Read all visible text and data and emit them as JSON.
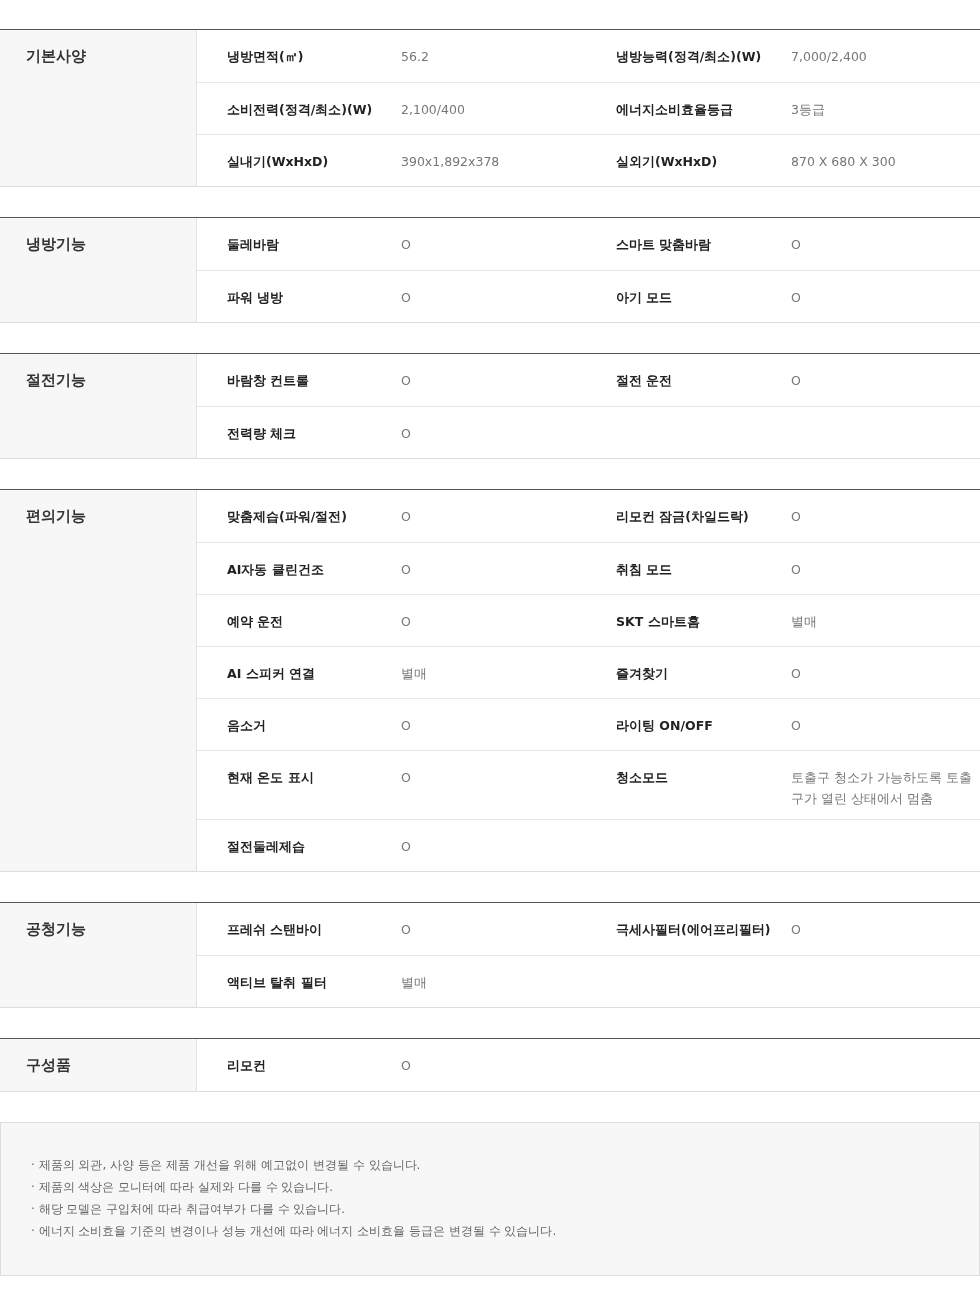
{
  "sections": [
    {
      "title": "기본사양",
      "rows": [
        [
          {
            "label": "냉방면적(㎡)",
            "value": "56.2"
          },
          {
            "label": "냉방능력(정격/최소)(W)",
            "value": "7,000/2,400"
          }
        ],
        [
          {
            "label": "소비전력(정격/최소)(W)",
            "value": "2,100/400"
          },
          {
            "label": "에너지소비효율등급",
            "value": "3등급"
          }
        ],
        [
          {
            "label": "실내기(WxHxD)",
            "value": "390x1,892x378"
          },
          {
            "label": "실외기(WxHxD)",
            "value": "870 X 680 X 300"
          }
        ]
      ]
    },
    {
      "title": "냉방기능",
      "rows": [
        [
          {
            "label": "둘레바람",
            "value": "O"
          },
          {
            "label": "스마트 맞춤바람",
            "value": "O"
          }
        ],
        [
          {
            "label": "파워 냉방",
            "value": "O"
          },
          {
            "label": "아기 모드",
            "value": "O"
          }
        ]
      ]
    },
    {
      "title": "절전기능",
      "rows": [
        [
          {
            "label": "바람창 컨트롤",
            "value": "O"
          },
          {
            "label": "절전 운전",
            "value": "O"
          }
        ],
        [
          {
            "label": "전력량 체크",
            "value": "O"
          }
        ]
      ]
    },
    {
      "title": "편의기능",
      "rows": [
        [
          {
            "label": "맞춤제습(파워/절전)",
            "value": "O"
          },
          {
            "label": "리모컨 잠금(차일드락)",
            "value": "O"
          }
        ],
        [
          {
            "label": "AI자동 클린건조",
            "value": "O"
          },
          {
            "label": "취침 모드",
            "value": "O"
          }
        ],
        [
          {
            "label": "예약 운전",
            "value": "O"
          },
          {
            "label": "SKT 스마트홈",
            "value": "별매"
          }
        ],
        [
          {
            "label": "AI 스피커 연결",
            "value": "별매"
          },
          {
            "label": "즐겨찾기",
            "value": "O"
          }
        ],
        [
          {
            "label": "음소거",
            "value": "O"
          },
          {
            "label": "라이팅 ON/OFF",
            "value": "O"
          }
        ],
        [
          {
            "label": "현재 온도 표시",
            "value": "O"
          },
          {
            "label": "청소모드",
            "value": "토출구 청소가 가능하도록 토출구가 열린 상태에서 멈춤"
          }
        ],
        [
          {
            "label": "절전둘레제습",
            "value": "O"
          }
        ]
      ]
    },
    {
      "title": "공청기능",
      "rows": [
        [
          {
            "label": "프레쉬 스탠바이",
            "value": "O"
          },
          {
            "label": "극세사필터(에어프리필터)",
            "value": "O"
          }
        ],
        [
          {
            "label": "액티브 탈취 필터",
            "value": "별매"
          }
        ]
      ]
    },
    {
      "title": "구성품",
      "rows": [
        [
          {
            "label": "리모컨",
            "value": "O"
          }
        ]
      ]
    }
  ],
  "notes": [
    "· 제품의 외관, 사양 등은 제품 개선을 위해 예고없이 변경될 수 있습니다.",
    "· 제품의 색상은 모니터에 따라 실제와 다를 수 있습니다.",
    "· 해당 모델은 구입처에 따라 취급여부가 다를 수 있습니다.",
    "· 에너지 소비효율 기준의 변경이나 성능 개선에 따라 에너지 소비효율 등급은 변경될 수 있습니다."
  ]
}
